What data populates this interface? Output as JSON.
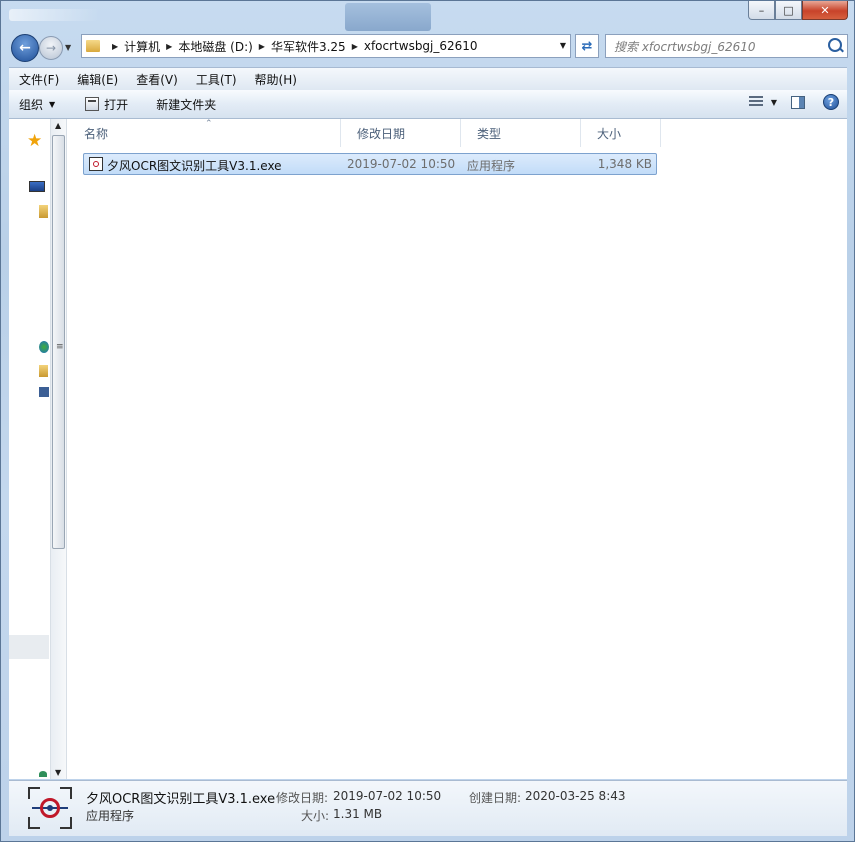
{
  "window": {
    "minimize_glyph": "–",
    "maximize_glyph": "□",
    "close_glyph": "✕"
  },
  "nav": {
    "breadcrumbs": [
      "计算机",
      "本地磁盘 (D:)",
      "华军软件3.25",
      "xfocrtwsbgj_62610"
    ],
    "search_placeholder": "搜索 xfocrtwsbgj_62610"
  },
  "menu": [
    "文件(F)",
    "编辑(E)",
    "查看(V)",
    "工具(T)",
    "帮助(H)"
  ],
  "toolbar": {
    "organize": "组织",
    "open": "打开",
    "new_folder": "新建文件夹"
  },
  "columns": [
    "名称",
    "修改日期",
    "类型",
    "大小"
  ],
  "files": [
    {
      "name": "夕风OCR图文识别工具V3.1.exe",
      "modified": "2019-07-02 10:50",
      "type": "应用程序",
      "size": "1,348 KB"
    }
  ],
  "details": {
    "name": "夕风OCR图文识别工具V3.1.exe",
    "type": "应用程序",
    "modified_label": "修改日期:",
    "modified_value": "2019-07-02 10:50",
    "created_label": "创建日期:",
    "created_value": "2020-03-25 8:43",
    "size_label": "大小:",
    "size_value": "1.31 MB"
  },
  "colors": {
    "selection": "#cfe3fa",
    "header_text": "#4c607a",
    "close_button": "#c8432a"
  },
  "icons": [
    "back-icon",
    "forward-icon",
    "folder-icon",
    "refresh-icon",
    "search-icon",
    "open-icon",
    "views-icon",
    "preview-pane-icon",
    "help-icon",
    "favorites-star-icon",
    "desktop-icon",
    "library-icon",
    "network-icon",
    "computer-icon",
    "exe-file-icon"
  ]
}
